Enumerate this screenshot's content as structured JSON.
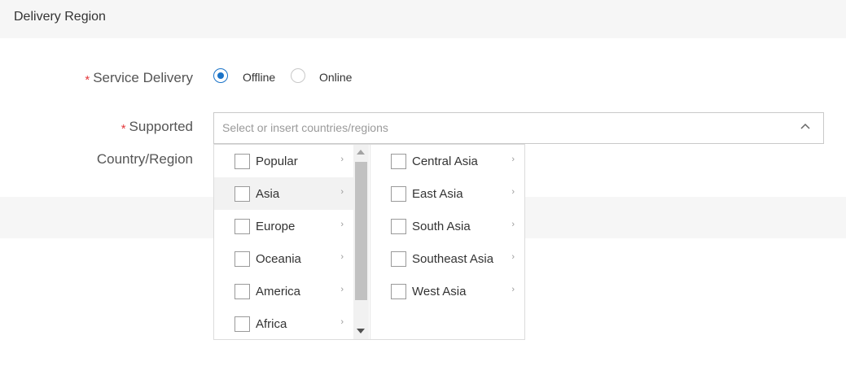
{
  "section": {
    "title": "Delivery Region"
  },
  "service_delivery": {
    "required_mark": "*",
    "label": "Service Delivery",
    "options": [
      {
        "label": "Offline",
        "checked": true
      },
      {
        "label": "Online",
        "checked": false
      }
    ]
  },
  "supported": {
    "required_mark": "*",
    "label_line1": "Supported",
    "label_line2": "Country/Region",
    "placeholder": "Select or insert countries/regions"
  },
  "dropdown": {
    "regions": [
      {
        "label": "Popular",
        "arrow": "›",
        "active": false
      },
      {
        "label": "Asia",
        "arrow": "›",
        "active": true
      },
      {
        "label": "Europe",
        "arrow": "›",
        "active": false
      },
      {
        "label": "Oceania",
        "arrow": "›",
        "active": false
      },
      {
        "label": "America",
        "arrow": "›",
        "active": false
      },
      {
        "label": "Africa",
        "arrow": "›",
        "active": false
      }
    ],
    "subregions": [
      {
        "label": "Central Asia",
        "arrow": "›"
      },
      {
        "label": "East Asia",
        "arrow": "›"
      },
      {
        "label": "South Asia",
        "arrow": "›"
      },
      {
        "label": "Southeast Asia",
        "arrow": "›"
      },
      {
        "label": "West Asia",
        "arrow": "›"
      }
    ]
  },
  "colors": {
    "accent": "#1a73c8",
    "required": "#e4393c",
    "header_bg": "#f6f6f6"
  }
}
